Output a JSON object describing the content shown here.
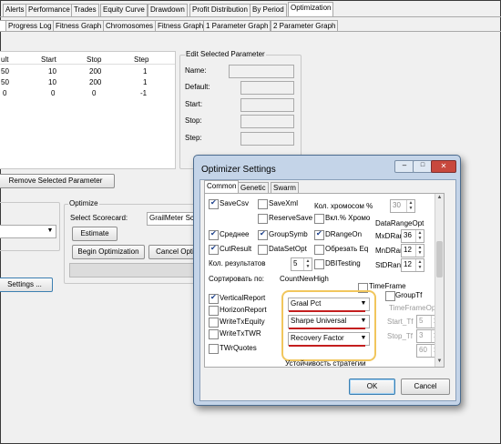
{
  "top_tabs": [
    "Alerts",
    "Performance",
    "Trades",
    "Equity Curve",
    "Drawdown",
    "Profit Distribution",
    "By Period",
    "Optimization"
  ],
  "sub_tabs": [
    "Progress Log",
    "Fitness Graph",
    "Chromosomes",
    "Fitness Graph",
    "1 Parameter Graph",
    "2 Parameter Graph"
  ],
  "param_table": {
    "headers": [
      "ult",
      "Start",
      "Stop",
      "Step"
    ],
    "rows": [
      [
        "50",
        "10",
        "200",
        "1"
      ],
      [
        "50",
        "10",
        "200",
        "1"
      ],
      [
        "0",
        "0",
        "0",
        "-1"
      ]
    ]
  },
  "edit_param": {
    "title": "Edit Selected Parameter",
    "labels": [
      "Name:",
      "Default:",
      "Start:",
      "Stop:",
      "Step:"
    ]
  },
  "remove_button": "Remove Selected Parameter",
  "optimize": {
    "title": "Optimize",
    "scorecard_label": "Select Scorecard:",
    "scorecard_value": "GrailMeter Sco",
    "estimate_button": "Estimate",
    "begin_button": "Begin Optimization",
    "cancel_button": "Cancel Opti"
  },
  "settings_button": "Settings ...",
  "dialog": {
    "title": "Optimizer Settings",
    "tabs": [
      "Common",
      "Genetic",
      "Swarm"
    ],
    "checkboxes": {
      "save_csv": "SaveCsv",
      "save_xml": "SaveXml",
      "reserve_save": "ReserveSave",
      "srednee": "Среднее",
      "group_symb": "GroupSymb",
      "drange_on": "DRangeOn",
      "cut_result": "CutResult",
      "data_set_opt": "DataSetOpt",
      "obrezat": "Обрезать Eq",
      "dbi_testing": "DBITesting",
      "vkl_hromo": "Вкл.% Хромо",
      "vertical_report": "VerticalReport",
      "horizon_report": "HorizonReport",
      "write_tx_equity": "WriteTxEquity",
      "write_tx_twr": "WriteTxTWR",
      "twr_quotes": "TWrQuotes",
      "time_frame": "TimeFrame",
      "group_tf": "GroupTf"
    },
    "chrom_label": "Кол. хромосом %",
    "chrom_value": "30",
    "drange_group": "DataRangeOpt",
    "mxd_label": "MxDRan",
    "mxd_value": "36",
    "mnd_label": "MnDRan",
    "mnd_value": "12",
    "std_label": "StDRan",
    "std_value": "12",
    "results_label": "Кол. результатов",
    "results_value": "5",
    "sort_label": "Сортировать по:",
    "sort_value": "CountNewHigh",
    "combos": [
      "Graal Pct",
      "Sharpe Universal",
      "Recovery Factor"
    ],
    "timeframe_group": "TimeFrameOpt",
    "start_tf_label": "Start_Tf",
    "start_tf_value": "5",
    "stop_tf_label": "Stop_Tf",
    "stop_tf_value": "3",
    "step_tf_value": "60",
    "stability_label": "Устойчивость стратегии",
    "ok_button": "OK",
    "cancel_button": "Cancel"
  }
}
